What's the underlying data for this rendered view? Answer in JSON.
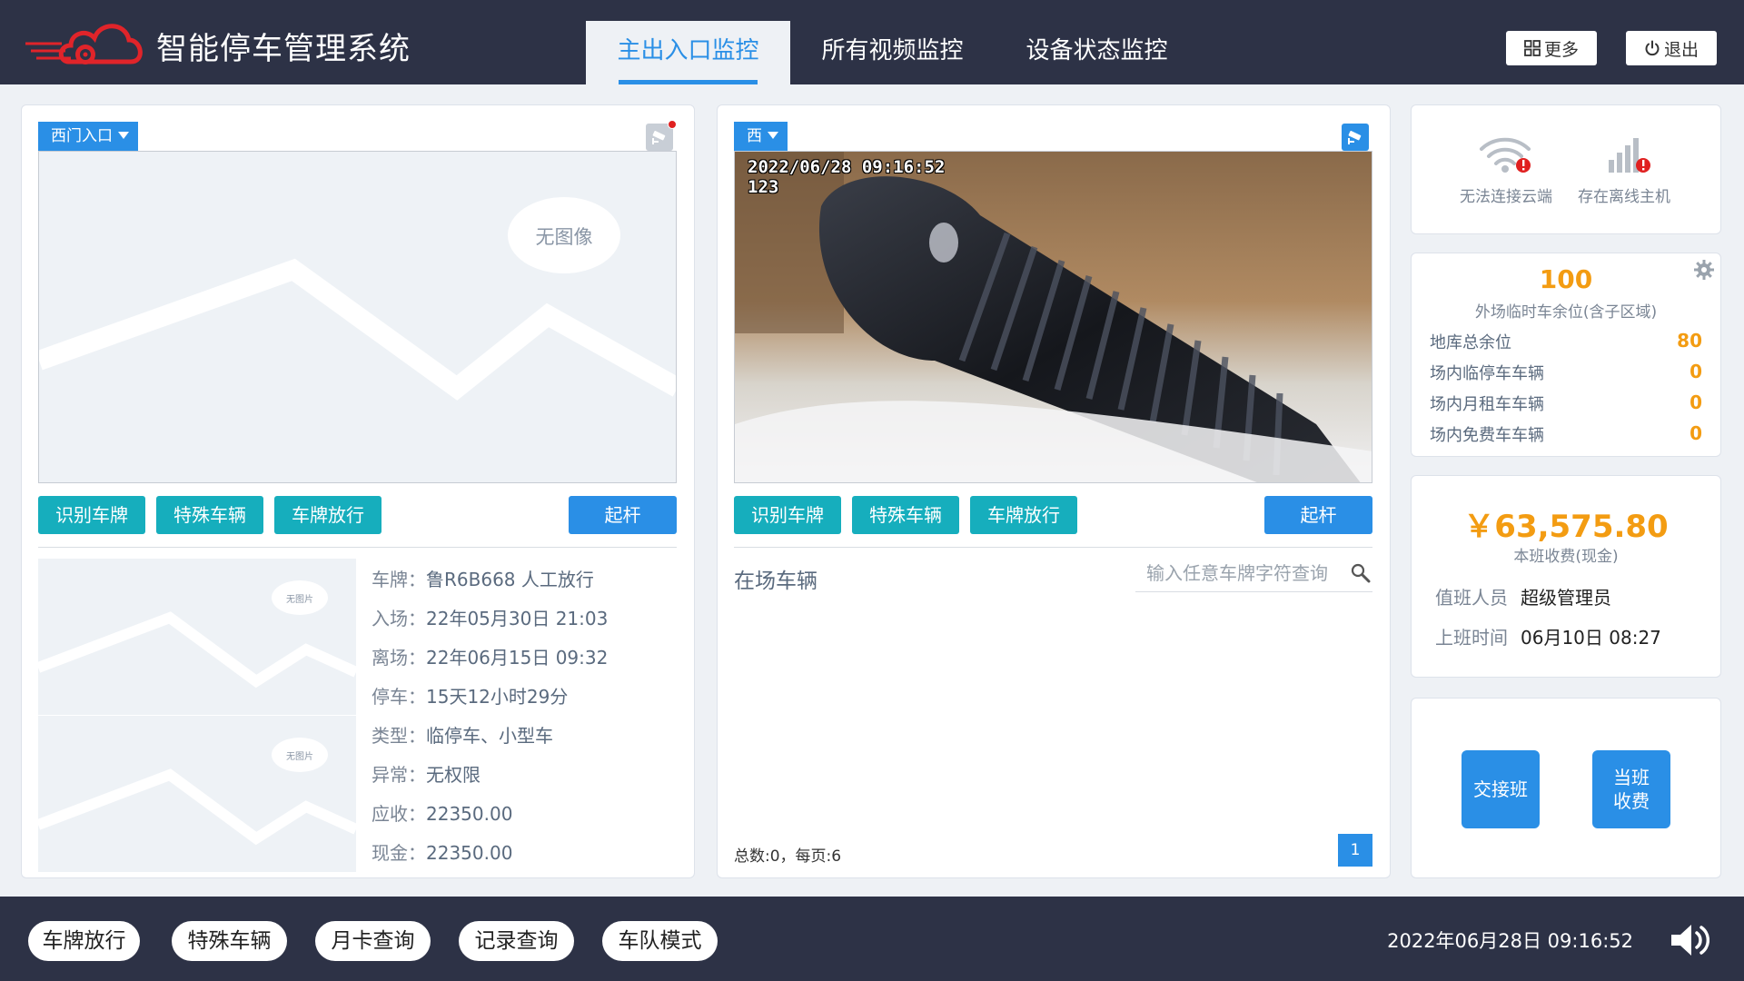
{
  "header": {
    "app_title": "智能停车管理系统",
    "tabs": [
      {
        "label": "主出入口监控",
        "active": true
      },
      {
        "label": "所有视频监控",
        "active": false
      },
      {
        "label": "设备状态监控",
        "active": false
      }
    ],
    "more_label": "更多",
    "exit_label": "退出"
  },
  "left_camera": {
    "selector_label": "西门入口",
    "no_image_text": "无图像",
    "buttons": {
      "recognize": "识别车牌",
      "special": "特殊车辆",
      "release": "车牌放行",
      "raise": "起杆"
    },
    "thumb_no_image_text": "无图片",
    "record": [
      {
        "label": "车牌：",
        "value": "鲁R6B668 人工放行"
      },
      {
        "label": "入场：",
        "value": "22年05月30日 21:03"
      },
      {
        "label": "离场：",
        "value": "22年06月15日 09:32"
      },
      {
        "label": "停车：",
        "value": "15天12小时29分"
      },
      {
        "label": "类型：",
        "value": "临停车、小型车"
      },
      {
        "label": "异常：",
        "value": "无权限"
      },
      {
        "label": "应收：",
        "value": "22350.00"
      },
      {
        "label": "现金：",
        "value": "22350.00"
      }
    ]
  },
  "right_camera": {
    "selector_label": "西",
    "osd_datetime": "2022/06/28 09:16:52",
    "osd_channel": "123",
    "buttons": {
      "recognize": "识别车牌",
      "special": "特殊车辆",
      "release": "车牌放行",
      "raise": "起杆"
    },
    "vehicles_title": "在场车辆",
    "search_placeholder": "输入任意车牌字符查询",
    "pager_text": "总数:0，每页:6",
    "current_page": "1"
  },
  "device_status": {
    "cloud_label": "无法连接云端",
    "host_label": "存在离线主机"
  },
  "spaces": {
    "outer_free": "100",
    "outer_free_label": "外场临时车余位(含子区域)",
    "rows": [
      {
        "label": "地库总余位",
        "value": "80"
      },
      {
        "label": "场内临停车车辆",
        "value": "0"
      },
      {
        "label": "场内月租车车辆",
        "value": "0"
      },
      {
        "label": "场内免费车车辆",
        "value": "0"
      }
    ]
  },
  "shift": {
    "amount": "￥63,575.80",
    "amount_label": "本班收费(现金)",
    "operator_label": "值班人员",
    "operator_value": "超级管理员",
    "start_label": "上班时间",
    "start_value": "06月10日 08:27"
  },
  "actions": {
    "handover": "交接班",
    "current_fee_line1": "当班",
    "current_fee_line2": "收费"
  },
  "footer": {
    "pills": [
      "车牌放行",
      "特殊车辆",
      "月卡查询",
      "记录查询",
      "车队模式"
    ],
    "datetime": "2022年06月28日 09:16:52"
  },
  "colors": {
    "header_bg": "#2d3246",
    "accent_blue": "#2a8fe6",
    "teal": "#16aebd",
    "orange": "#f39c12",
    "logo_red": "#e0242a"
  },
  "icons": {
    "logo": "red-cloud-logo-icon",
    "more": "grid-icon",
    "exit": "power-icon",
    "camera": "cctv-camera-icon",
    "wifi": "wifi-error-icon",
    "signal": "signal-bars-error-icon",
    "gear": "gear-icon",
    "search": "search-icon",
    "volume": "volume-icon"
  }
}
